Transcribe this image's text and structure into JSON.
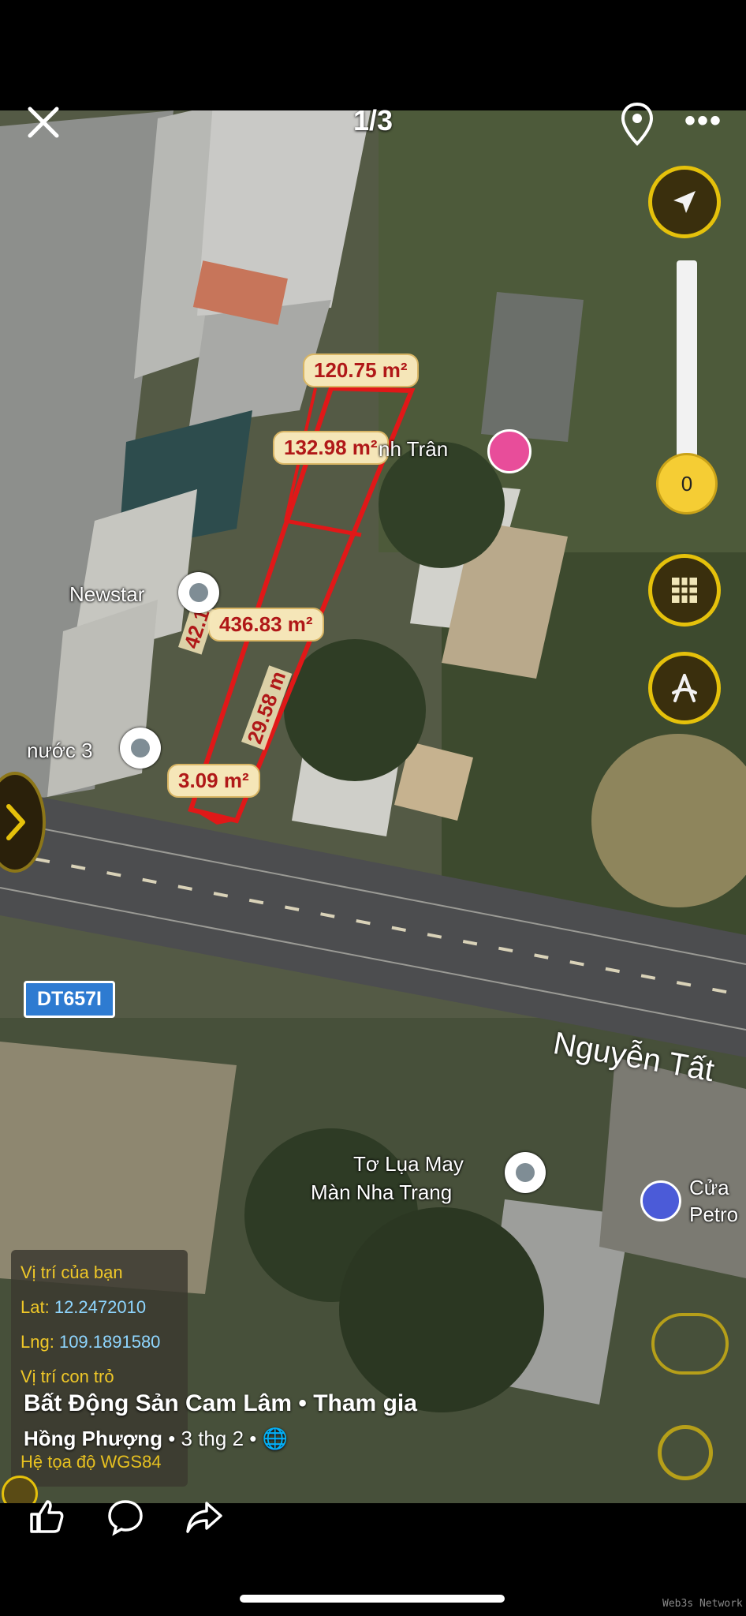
{
  "viewer": {
    "counter": "1/3",
    "slider_value": "0"
  },
  "plot": {
    "areas": [
      "120.75 m²",
      "132.98 m²",
      "436.83 m²",
      "3.09 m²"
    ],
    "dimensions": [
      "42.1",
      "29.58 m"
    ]
  },
  "poi": {
    "newstar": "Newstar",
    "nuoc3": "nước 3",
    "hotel": "nh Trân",
    "silk_line1": "Tơ Lụa May",
    "silk_line2": "Màn Nha Trang",
    "gas_line1": "Cửa",
    "gas_line2": "Petro"
  },
  "roads": {
    "badge": "DT657I",
    "name": "Nguyễn Tất"
  },
  "location_info": {
    "your_location_label": "Vị trí của bạn",
    "lat_label": "Lat:",
    "lat_value": "12.2472010",
    "lng_label": "Lng:",
    "lng_value": "109.1891580",
    "pointer_label": "Vị trí con trỏ",
    "coord_system": "Hệ tọa độ WGS84"
  },
  "post": {
    "group": "Bất Động Sản Cam Lâm • Tham gia",
    "author": "Hồng Phượng",
    "date": "3 thg 2"
  },
  "colors": {
    "accent_yellow": "#e5c10b",
    "plot_outline": "#e01818",
    "label_bg": "#f5e6b8"
  },
  "watermark": "Web3s Network"
}
